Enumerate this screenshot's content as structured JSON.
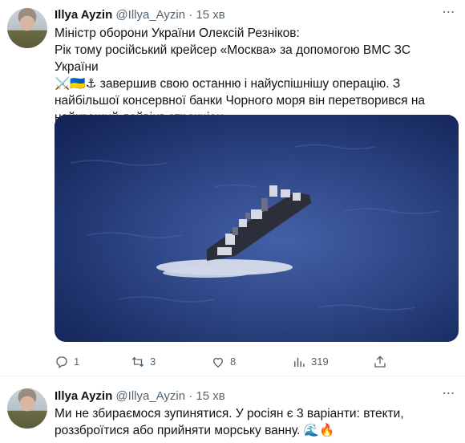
{
  "tweets": [
    {
      "author": {
        "name": "Illya Ayzin",
        "handle": "@Illya_Ayzin",
        "time": "15 хв"
      },
      "separator": "·",
      "text": "Міністр оборони України Олексій Резніков:\nРік тому російський крейсер «Москва» за допомогою ВМС ЗС України\n⚔️🇺🇦⚓ завершив свою останню і найуспішнішу операцію. З\nнайбільшої консервної банки Чорного моря він перетворився на\nнайкращий дайвінг-атракціон.",
      "actions": {
        "replies": "1",
        "retweets": "3",
        "likes": "8",
        "views": "319"
      }
    },
    {
      "author": {
        "name": "Illya Ayzin",
        "handle": "@Illya_Ayzin",
        "time": "15 хв"
      },
      "separator": "·",
      "text": "Ми не збираємося зупинятися. У росіян є 3 варіанти: втекти,\nроззброїтися або прийняти морську ванну. 🌊🔥"
    }
  ],
  "icons": {
    "reply": "reply-icon",
    "retweet": "retweet-icon",
    "like": "heart-icon",
    "views": "analytics-icon",
    "share": "share-icon",
    "more": "more-icon"
  },
  "colors": {
    "text": "#0f1419",
    "secondary": "#536471",
    "border": "#eff3f4"
  }
}
